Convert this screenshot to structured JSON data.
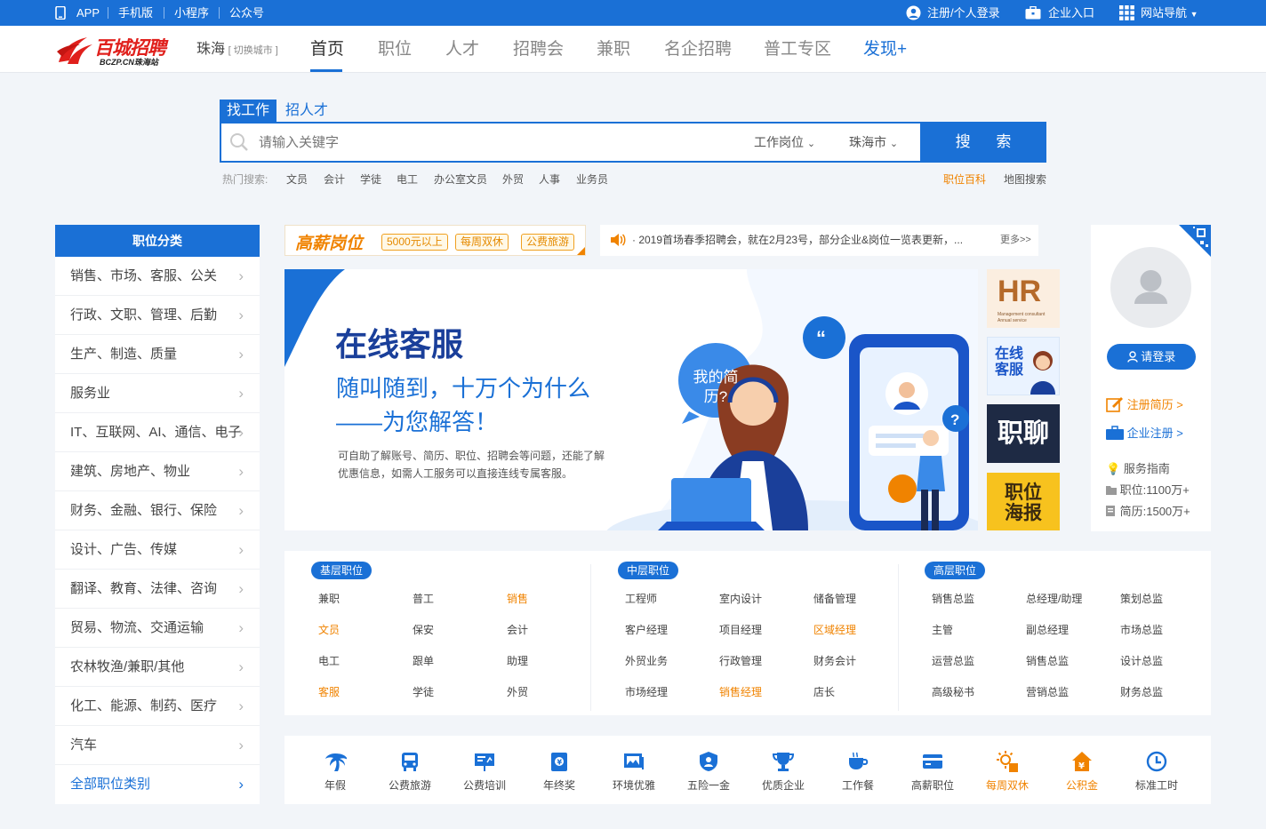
{
  "topbar": {
    "links": [
      "APP",
      "手机版",
      "小程序",
      "公众号"
    ],
    "login": "注册/个人登录",
    "company": "企业入口",
    "sitenav": "网站导航"
  },
  "header": {
    "logo_text": "百城招聘",
    "logo_sub": "BCZP.CN珠海站",
    "city": "珠海",
    "switch_city": "[ 切换城市 ]",
    "nav": [
      "首页",
      "职位",
      "人才",
      "招聘会",
      "兼职",
      "名企招聘",
      "普工专区",
      "发现+"
    ]
  },
  "search": {
    "tabs": [
      "找工作",
      "招人才"
    ],
    "placeholder": "请输入关键字",
    "type_select": "工作岗位",
    "city_select": "珠海市",
    "button": "搜 索",
    "hot_label": "热门搜索:",
    "hot": [
      "文员",
      "会计",
      "学徒",
      "电工",
      "办公室文员",
      "外贸",
      "人事",
      "业务员"
    ],
    "right_links": [
      "职位百科",
      "地图搜索"
    ]
  },
  "categories": {
    "title": "职位分类",
    "items": [
      "销售、市场、客服、公关",
      "行政、文职、管理、后勤",
      "生产、制造、质量",
      "服务业",
      "IT、互联网、AI、通信、电子",
      "建筑、房地产、物业",
      "财务、金融、银行、保险",
      "设计、广告、传媒",
      "翻译、教育、法律、咨询",
      "贸易、物流、交通运输",
      "农林牧渔/兼职/其他",
      "化工、能源、制药、医疗",
      "汽车"
    ],
    "all": "全部职位类别"
  },
  "promo": {
    "title": "高薪岗位",
    "tags": [
      "5000元以上",
      "每周双休",
      "公费旅游"
    ]
  },
  "notice": {
    "text": "· 2019首场春季招聘会，就在2月23号，部分企业&岗位一览表更新，...",
    "more": "更多>>"
  },
  "banner": {
    "title": "在线客服",
    "line1": "随叫随到，十万个为什么",
    "line2": "——为您解答！",
    "desc1": "可自助了解账号、简历、职位、招聘会等问题，还能了解",
    "desc2": "优惠信息，如需人工服务可以直接连线专属客服。",
    "bubble": "我的简历?"
  },
  "side_tiles": {
    "hr": "HR",
    "hr_sub": "Management consultant",
    "hr_sub2": "Annual service",
    "cs": "在线客服",
    "chat": "职聊",
    "poster": "职位海报"
  },
  "profile": {
    "login_btn": "请登录",
    "register_resume": "注册简历 >",
    "register_company": "企业注册 >",
    "guide": "服务指南",
    "jobs": "职位:1100万+",
    "resumes": "简历:1500万+"
  },
  "levels": [
    {
      "name": "基层职位",
      "items": [
        "兼职",
        "普工",
        "销售",
        "文员",
        "保安",
        "会计",
        "电工",
        "跟单",
        "助理",
        "客服",
        "学徒",
        "外贸"
      ],
      "highlight": [
        "销售",
        "文员",
        "客服"
      ]
    },
    {
      "name": "中层职位",
      "items": [
        "工程师",
        "室内设计",
        "储备管理",
        "客户经理",
        "项目经理",
        "区域经理",
        "外贸业务",
        "行政管理",
        "财务会计",
        "市场经理",
        "销售经理",
        "店长"
      ],
      "highlight": [
        "区域经理",
        "销售经理"
      ]
    },
    {
      "name": "高层职位",
      "items": [
        "销售总监",
        "总经理/助理",
        "策划总监",
        "主管",
        "副总经理",
        "市场总监",
        "运营总监",
        "销售总监",
        "设计总监",
        "高级秘书",
        "营销总监",
        "财务总监"
      ],
      "highlight": []
    }
  ],
  "benefits": [
    "年假",
    "公费旅游",
    "公费培训",
    "年终奖",
    "环境优雅",
    "五险一金",
    "优质企业",
    "工作餐",
    "高薪职位",
    "每周双休",
    "公积金",
    "标准工时"
  ],
  "benefits_highlight": [
    "每周双休",
    "公积金"
  ],
  "colors": {
    "primary": "#1a70d6",
    "accent": "#f08300",
    "logo_red": "#e0201c"
  }
}
